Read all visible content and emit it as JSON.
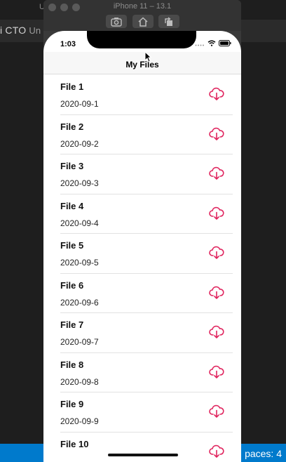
{
  "editor": {
    "title": "i CTO",
    "title_sub": "Un",
    "top_letter": "U",
    "status_right": "paces: 4"
  },
  "simulator": {
    "title": "iPhone 11 – 13.1",
    "buttons": [
      "screenshot-icon",
      "home-icon",
      "rotate-icon"
    ]
  },
  "phone": {
    "time": "1:03",
    "status_icons": [
      "signal-icon",
      "wifi-icon",
      "battery-icon"
    ]
  },
  "nav": {
    "title": "My Files"
  },
  "files": [
    {
      "name": "File 1",
      "date": "2020-09-1"
    },
    {
      "name": "File 2",
      "date": "2020-09-2"
    },
    {
      "name": "File 3",
      "date": "2020-09-3"
    },
    {
      "name": "File 4",
      "date": "2020-09-4"
    },
    {
      "name": "File 5",
      "date": "2020-09-5"
    },
    {
      "name": "File 6",
      "date": "2020-09-6"
    },
    {
      "name": "File 7",
      "date": "2020-09-7"
    },
    {
      "name": "File 8",
      "date": "2020-09-8"
    },
    {
      "name": "File 9",
      "date": "2020-09-9"
    },
    {
      "name": "File 10",
      "date": ""
    }
  ],
  "colors": {
    "accent": "#e0245e",
    "statusbar": "#007acc"
  },
  "download_icon": "cloud-download-icon"
}
